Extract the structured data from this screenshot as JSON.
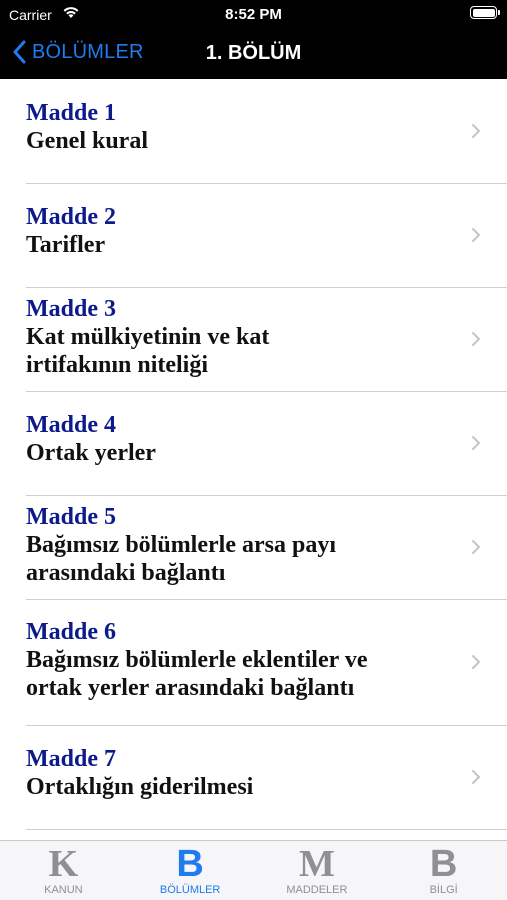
{
  "status": {
    "carrier": "Carrier",
    "time": "8:52 PM"
  },
  "nav": {
    "back_label": "BÖLÜMLER",
    "title": "1. BÖLÜM"
  },
  "items": [
    {
      "num": "Madde 1",
      "title_lines": [
        "Genel kural"
      ]
    },
    {
      "num": "Madde 2",
      "title_lines": [
        "Tarifler"
      ]
    },
    {
      "num": "Madde 3",
      "title_lines": [
        "Kat mülkiyetinin ve kat",
        "irtifakının niteliği"
      ]
    },
    {
      "num": "Madde 4",
      "title_lines": [
        "Ortak yerler"
      ]
    },
    {
      "num": "Madde 5",
      "title_lines": [
        "Bağımsız bölümlerle arsa payı",
        "arasındaki bağlantı"
      ]
    },
    {
      "num": "Madde 6",
      "title_lines": [
        "Bağımsız bölümlerle eklentiler ve",
        "ortak yerler arasındaki bağlantı"
      ]
    },
    {
      "num": "Madde 7",
      "title_lines": [
        "Ortaklığın giderilmesi"
      ]
    }
  ],
  "tabs": [
    {
      "glyph": "K",
      "label": "KANUN",
      "active": false
    },
    {
      "glyph": "B",
      "label": "BÖLÜMLER",
      "active": true
    },
    {
      "glyph": "M",
      "label": "MADDELER",
      "active": false
    },
    {
      "glyph": "B",
      "label": "BİLGİ",
      "active": false
    }
  ],
  "colors": {
    "accent": "#1e7bf0",
    "madde_blue": "#0d1a8c",
    "inactive_tab": "#8f8f94"
  }
}
